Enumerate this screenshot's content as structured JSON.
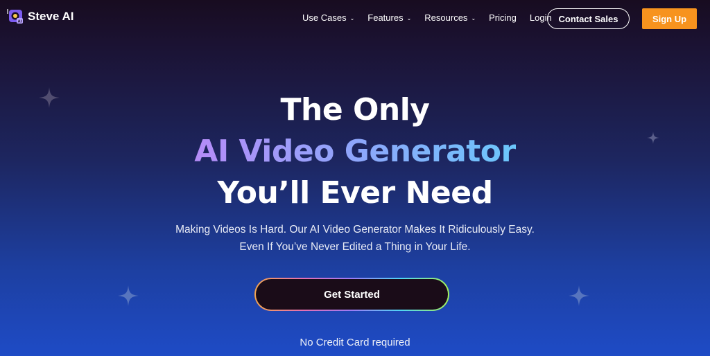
{
  "brand": {
    "name": "Steve AI",
    "logo_icon": "steve-ai-logo"
  },
  "nav": {
    "items": [
      {
        "label": "Use Cases",
        "has_dropdown": true
      },
      {
        "label": "Features",
        "has_dropdown": true
      },
      {
        "label": "Resources",
        "has_dropdown": true
      },
      {
        "label": "Pricing",
        "has_dropdown": false
      },
      {
        "label": "Login",
        "has_dropdown": false
      }
    ],
    "contact_label": "Contact Sales",
    "signup_label": "Sign Up"
  },
  "hero": {
    "line1": "The Only",
    "line2": "AI Video Generator",
    "line3": "You’ll Ever Need",
    "sub1": "Making Videos Is Hard. Our AI Video Generator Makes It Ridiculously Easy.",
    "sub2": "Even If You’ve Never Edited a Thing in Your Life.",
    "cta_label": "Get Started",
    "note": "No Credit Card required"
  },
  "colors": {
    "signup_bg": "#f7931e",
    "gradient_text_start": "#b58cf7",
    "gradient_text_end": "#6bc7fb"
  }
}
